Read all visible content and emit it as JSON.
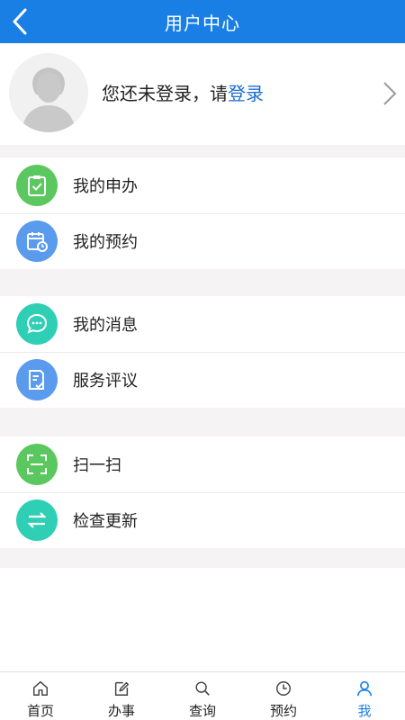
{
  "header": {
    "title": "用户中心"
  },
  "profile": {
    "prompt": "您还未登录，请",
    "login_link": "登录"
  },
  "groups": [
    {
      "items": [
        {
          "label": "我的申办",
          "icon": "clipboard-check-icon",
          "color": "#5ac85e"
        },
        {
          "label": "我的预约",
          "icon": "calendar-clock-icon",
          "color": "#5a9bee"
        }
      ]
    },
    {
      "items": [
        {
          "label": "我的消息",
          "icon": "chat-bubble-icon",
          "color": "#2fcfb5"
        },
        {
          "label": "服务评议",
          "icon": "document-check-icon",
          "color": "#5a9bee"
        }
      ]
    },
    {
      "items": [
        {
          "label": "扫一扫",
          "icon": "scan-icon",
          "color": "#5ac85e"
        },
        {
          "label": "检查更新",
          "icon": "swap-arrows-icon",
          "color": "#2fcfb5"
        }
      ]
    }
  ],
  "tabbar": {
    "tabs": [
      {
        "label": "首页",
        "icon": "home-icon"
      },
      {
        "label": "办事",
        "icon": "edit-icon"
      },
      {
        "label": "查询",
        "icon": "search-icon"
      },
      {
        "label": "预约",
        "icon": "clock-icon"
      },
      {
        "label": "我",
        "icon": "user-icon",
        "active": true
      }
    ],
    "active_color": "#1a7fe4"
  }
}
